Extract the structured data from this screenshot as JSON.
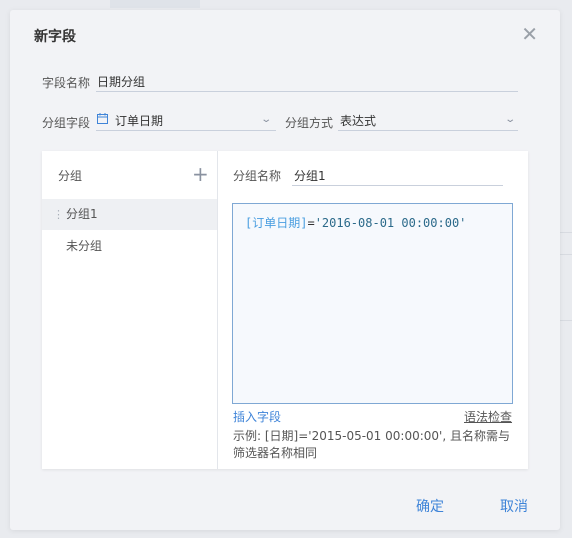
{
  "dialog": {
    "title": "新字段",
    "close_icon": "close-icon",
    "field_name": {
      "label": "字段名称",
      "value": "日期分组"
    },
    "group_field": {
      "label": "分组字段",
      "icon": "calendar-icon",
      "value": "订单日期"
    },
    "group_method": {
      "label": "分组方式",
      "value": "表达式"
    },
    "left_panel": {
      "header": "分组",
      "add_icon": "plus-icon",
      "items": [
        {
          "label": "分组1",
          "selected": true
        },
        {
          "label": "未分组",
          "selected": false
        }
      ]
    },
    "right_panel": {
      "group_name": {
        "label": "分组名称",
        "value": "分组1"
      },
      "expression": {
        "field": "[订单日期]",
        "operator": "=",
        "literal": "'2016-08-01 00:00:00'"
      },
      "insert_field": "插入字段",
      "syntax_check": "语法检查",
      "hint": "示例: [日期]='2015-05-01 00:00:00', 且名称需与筛选器名称相同"
    },
    "buttons": {
      "ok": "确定",
      "cancel": "取消"
    }
  },
  "colors": {
    "accent": "#3f84d8",
    "field_token": "#4a9ee0",
    "editor_border": "#7fa8d4"
  }
}
